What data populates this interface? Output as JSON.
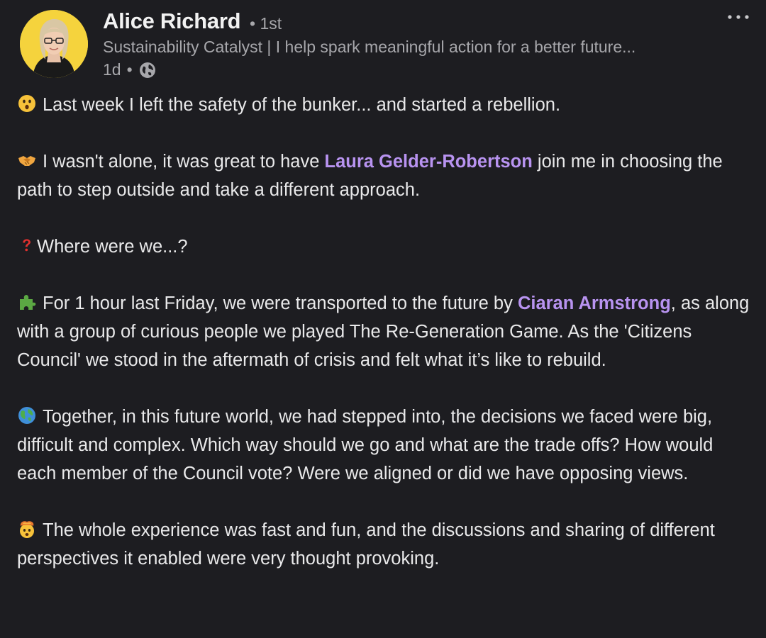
{
  "author": {
    "name": "Alice Richard",
    "degree": "• 1st",
    "headline": "Sustainability Catalyst | I help spark meaningful action for a better future...",
    "time": "1d",
    "separator": "•"
  },
  "icons": {
    "more": "more-horizontal-icon",
    "visibility": "globe-icon"
  },
  "colors": {
    "background": "#1d1d21",
    "mention": "#b893f0",
    "text": "#e9e9ea",
    "muted": "#a7a7ab"
  },
  "post": {
    "p1": "Last week I left the safety of the bunker... and started a rebellion.",
    "p2_before": "I wasn't alone, it was great to have ",
    "p2_mention": "Laura Gelder-Robertson",
    "p2_after": " join me in choosing the path to step outside and take a different approach.",
    "p3": "Where were we...?",
    "p4_before": "For 1 hour last Friday, we were transported to the future by ",
    "p4_mention": "Ciaran Armstrong",
    "p4_after": ", as along with a group of curious people we played The Re-Generation Game. As the 'Citizens Council' we stood in the aftermath of crisis and felt what it’s like to rebuild.",
    "p5": "Together, in this future world, we had stepped into, the decisions we faced were big, difficult and complex. Which way should we go and what are the trade offs? How would each member of the Council vote? Were we aligned or did we have opposing views.",
    "p6": "The whole experience was fast and fun, and the discussions and sharing of different perspectives it enabled were very thought provoking."
  }
}
